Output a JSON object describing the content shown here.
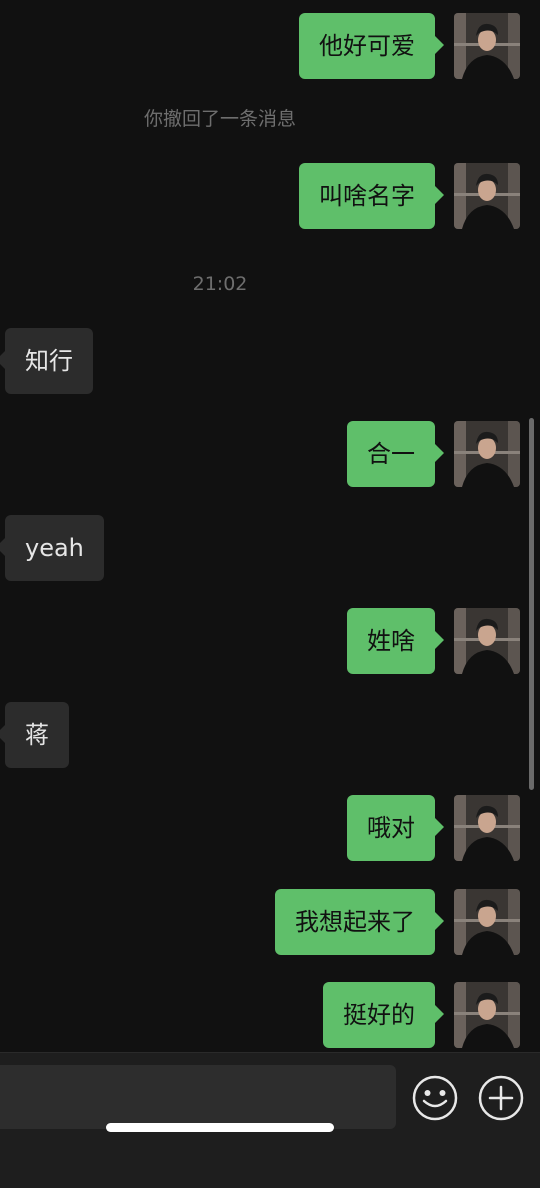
{
  "conversation": {
    "sent_1": "他好可爱",
    "system_recall": "你撤回了一条消息",
    "sent_2": "叫啥名字",
    "timestamp": "21:02",
    "received_1": "知行",
    "sent_3": "合一",
    "received_2": "yeah",
    "sent_4": "姓啥",
    "received_3": "蒋",
    "sent_5": "哦对",
    "sent_6": "我想起来了",
    "sent_7": "挺好的"
  },
  "input_bar": {
    "emoji_icon": "emoji-icon",
    "more_icon": "plus-icon"
  },
  "colors": {
    "background": "#111111",
    "sent_bubble": "#5fbf6a",
    "received_bubble": "#2c2c2c",
    "input_bar": "#1e1e1e"
  }
}
